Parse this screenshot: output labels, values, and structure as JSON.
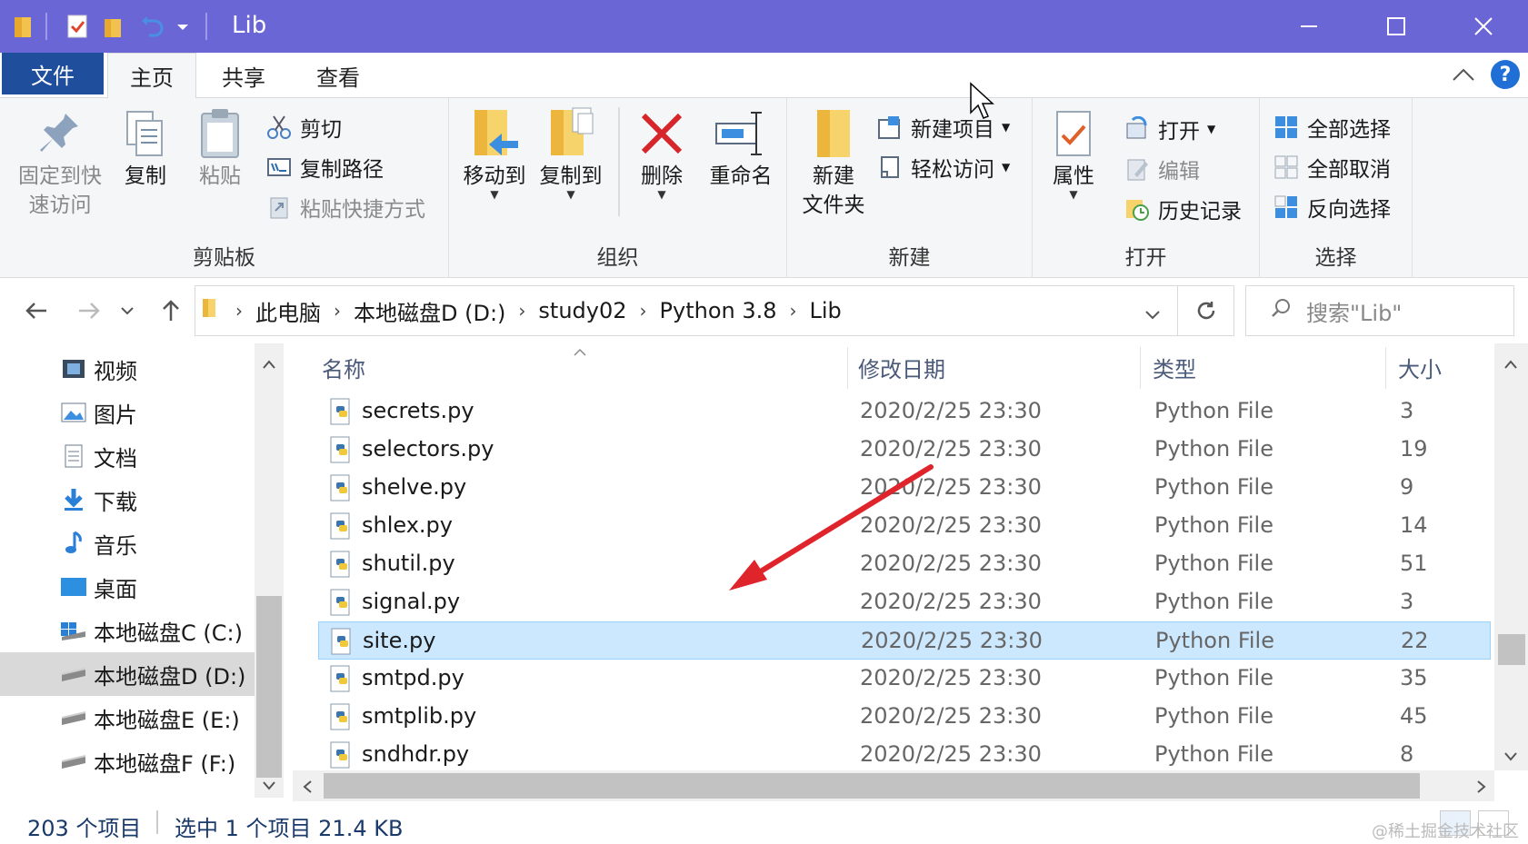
{
  "window": {
    "title": "Lib"
  },
  "tabs": {
    "file": "文件",
    "home": "主页",
    "share": "共享",
    "view": "查看"
  },
  "ribbon": {
    "clipboard": {
      "label": "剪贴板",
      "pin_line1": "固定到快",
      "pin_line2": "速访问",
      "copy": "复制",
      "paste": "粘贴",
      "cut": "剪切",
      "copy_path": "复制路径",
      "paste_shortcut": "粘贴快捷方式"
    },
    "organize": {
      "label": "组织",
      "move_to": "移动到",
      "copy_to": "复制到",
      "delete": "删除",
      "rename": "重命名"
    },
    "new": {
      "label": "新建",
      "new_folder_line1": "新建",
      "new_folder_line2": "文件夹",
      "new_item": "新建项目",
      "easy_access": "轻松访问"
    },
    "open": {
      "label": "打开",
      "properties": "属性",
      "open": "打开",
      "edit": "编辑",
      "history": "历史记录"
    },
    "select": {
      "label": "选择",
      "select_all": "全部选择",
      "select_none": "全部取消",
      "invert": "反向选择"
    }
  },
  "address": {
    "crumbs": [
      "此电脑",
      "本地磁盘D (D:)",
      "study02",
      "Python 3.8",
      "Lib"
    ],
    "search_placeholder": "搜索\"Lib\""
  },
  "nav": {
    "items": [
      {
        "label": "视频",
        "icon": "video-icon"
      },
      {
        "label": "图片",
        "icon": "pictures-icon"
      },
      {
        "label": "文档",
        "icon": "documents-icon"
      },
      {
        "label": "下载",
        "icon": "download-icon"
      },
      {
        "label": "音乐",
        "icon": "music-icon"
      },
      {
        "label": "桌面",
        "icon": "desktop-icon"
      },
      {
        "label": "本地磁盘C (C:)",
        "icon": "drive-c-icon"
      },
      {
        "label": "本地磁盘D (D:)",
        "icon": "drive-icon",
        "selected": true
      },
      {
        "label": "本地磁盘E (E:)",
        "icon": "drive-icon"
      },
      {
        "label": "本地磁盘F (F:)",
        "icon": "drive-icon"
      }
    ]
  },
  "list": {
    "columns": {
      "name": "名称",
      "modified": "修改日期",
      "type": "类型",
      "size": "大小"
    },
    "rows": [
      {
        "name": "secrets.py",
        "modified": "2020/2/25 23:30",
        "type": "Python File",
        "size": "3"
      },
      {
        "name": "selectors.py",
        "modified": "2020/2/25 23:30",
        "type": "Python File",
        "size": "19"
      },
      {
        "name": "shelve.py",
        "modified": "2020/2/25 23:30",
        "type": "Python File",
        "size": "9"
      },
      {
        "name": "shlex.py",
        "modified": "2020/2/25 23:30",
        "type": "Python File",
        "size": "14"
      },
      {
        "name": "shutil.py",
        "modified": "2020/2/25 23:30",
        "type": "Python File",
        "size": "51"
      },
      {
        "name": "signal.py",
        "modified": "2020/2/25 23:30",
        "type": "Python File",
        "size": "3"
      },
      {
        "name": "site.py",
        "modified": "2020/2/25 23:30",
        "type": "Python File",
        "size": "22",
        "selected": true
      },
      {
        "name": "smtpd.py",
        "modified": "2020/2/25 23:30",
        "type": "Python File",
        "size": "35"
      },
      {
        "name": "smtplib.py",
        "modified": "2020/2/25 23:30",
        "type": "Python File",
        "size": "45"
      },
      {
        "name": "sndhdr.py",
        "modified": "2020/2/25 23:30",
        "type": "Python File",
        "size": "8"
      }
    ]
  },
  "status": {
    "count": "203 个项目",
    "selection": "选中 1 个项目  21.4 KB"
  },
  "watermark": "@稀土掘金技术社区",
  "colors": {
    "titlebar": "#6b66d6",
    "file_tab": "#1f4e9c",
    "selection": "#cce8ff",
    "annotation_arrow": "#e0242b"
  }
}
